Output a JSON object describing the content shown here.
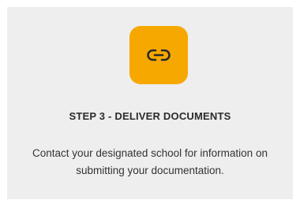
{
  "card": {
    "icon": "link-icon",
    "icon_background": "#f7a800",
    "icon_color": "#2b2b2b",
    "title": "STEP 3 - DELIVER DOCUMENTS",
    "description": "Contact your designated school for information on submitting your documentation."
  }
}
